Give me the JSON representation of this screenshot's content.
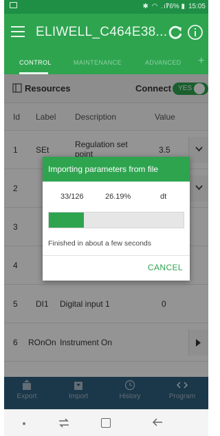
{
  "status_bar": {
    "icons": "✱ ◠ .ıl",
    "battery": "76% ▮",
    "time": "15:05"
  },
  "app_bar": {
    "title": "ELIWELL_C464E38..."
  },
  "tabs": [
    {
      "label": "CONTROL",
      "active": true
    },
    {
      "label": "MAINTENANCE",
      "active": false
    },
    {
      "label": "ADVANCED",
      "active": false
    }
  ],
  "tab_add": "+",
  "resources": {
    "label": "Resources",
    "connect_label": "Connect",
    "toggle_text": "YES"
  },
  "table": {
    "headers": [
      "Id",
      "Label",
      "Description",
      "Value"
    ],
    "rows": [
      {
        "id": "1",
        "label": "SEt",
        "description": "Regulation set point",
        "value": "3.5",
        "button": "chevron-down-icon"
      },
      {
        "id": "2",
        "label": "",
        "description": "",
        "value": "",
        "button": "chevron-down-icon"
      },
      {
        "id": "3",
        "label": "",
        "description": "",
        "value": "",
        "button": ""
      },
      {
        "id": "4",
        "label": "",
        "description": "",
        "value": "",
        "button": ""
      },
      {
        "id": "5",
        "label": "DI1",
        "description": "Digital input 1",
        "value": "0",
        "button": ""
      },
      {
        "id": "6",
        "label": "ROnOn",
        "description": "Instrument On",
        "value": "",
        "button": "play-icon"
      }
    ]
  },
  "dialog": {
    "title": "Importing parameters from file",
    "count": "33/126",
    "percent": "26.19%",
    "unit": "dt",
    "progress_fraction": 0.2619,
    "message": "Finished in about a few seconds",
    "cancel_label": "CANCEL"
  },
  "bottom_bar": {
    "items": [
      {
        "label": "Export",
        "icon": "export-icon"
      },
      {
        "label": "Import",
        "icon": "import-icon"
      },
      {
        "label": "History",
        "icon": "history-icon"
      },
      {
        "label": "Program",
        "icon": "code-icon"
      }
    ]
  },
  "colors": {
    "primary": "#2ea44f",
    "status_bar": "#1e8f45",
    "bottom_bar": "#2f5f80"
  }
}
